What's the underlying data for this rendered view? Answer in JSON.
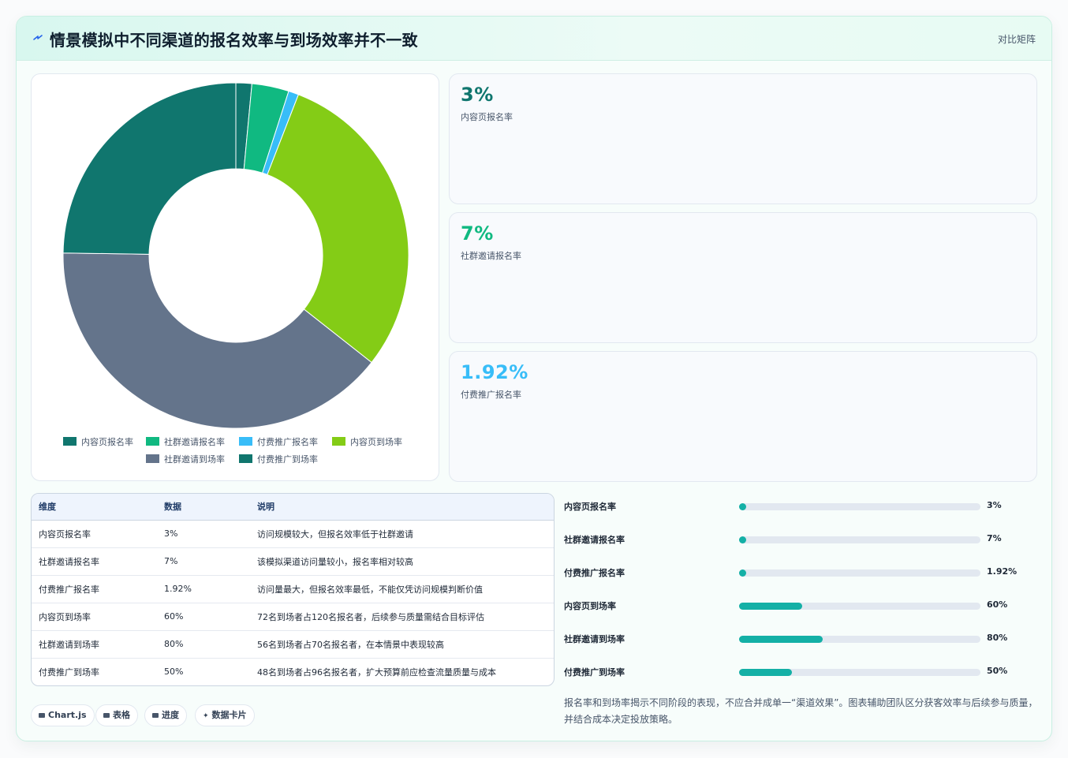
{
  "header": {
    "title": "情景模拟中不同渠道的报名效率与到场效率并不一致",
    "tag": "对比矩阵"
  },
  "colors": {
    "accent": "#14b0a6",
    "kpi_colors": [
      "#0f766e",
      "#10b981",
      "#38bdf8"
    ]
  },
  "chart_data": {
    "type": "pie",
    "subtype": "doughnut",
    "categories": [
      "内容页报名率",
      "社群邀请报名率",
      "付费推广报名率",
      "内容页到场率",
      "社群邀请到场率",
      "付费推广到场率"
    ],
    "values": [
      3,
      7,
      1.92,
      60,
      80,
      50
    ],
    "colors": [
      "#10766e",
      "#10b981",
      "#38bdf8",
      "#84cc16",
      "#64748b",
      "#10766e"
    ],
    "legend_position": "bottom"
  },
  "kpis": [
    {
      "value": "3%",
      "label": "内容页报名率"
    },
    {
      "value": "7%",
      "label": "社群邀请报名率"
    },
    {
      "value": "1.92%",
      "label": "付费推广报名率"
    }
  ],
  "table": {
    "headers": [
      "维度",
      "数据",
      "说明"
    ],
    "rows": [
      [
        "内容页报名率",
        "3%",
        "访问规模较大，但报名效率低于社群邀请"
      ],
      [
        "社群邀请报名率",
        "7%",
        "该模拟渠道访问量较小，报名率相对较高"
      ],
      [
        "付费推广报名率",
        "1.92%",
        "访问量最大，但报名效率最低，不能仅凭访问规模判断价值"
      ],
      [
        "内容页到场率",
        "60%",
        "72名到场者占120名报名者，后续参与质量需结合目标评估"
      ],
      [
        "社群邀请到场率",
        "80%",
        "56名到场者占70名报名者，在本情景中表现较高"
      ],
      [
        "付费推广到场率",
        "50%",
        "48名到场者占96名报名者，扩大预算前应检查流量质量与成本"
      ]
    ]
  },
  "progress": [
    {
      "label": "内容页报名率",
      "value_text": "3%",
      "value": 3
    },
    {
      "label": "社群邀请报名率",
      "value_text": "7%",
      "value": 7
    },
    {
      "label": "付费推广报名率",
      "value_text": "1.92%",
      "value": 1.92
    },
    {
      "label": "内容页到场率",
      "value_text": "60%",
      "value": 60
    },
    {
      "label": "社群邀请到场率",
      "value_text": "80%",
      "value": 80
    },
    {
      "label": "付费推广到场率",
      "value_text": "50%",
      "value": 50
    }
  ],
  "progress_max": 230,
  "note": "报名率和到场率揭示不同阶段的表现，不应合并成单一“渠道效果”。图表辅助团队区分获客效率与后续参与质量，并结合成本决定投放策略。",
  "chips": [
    "Chart.js",
    "表格",
    "进度",
    "数据卡片"
  ]
}
